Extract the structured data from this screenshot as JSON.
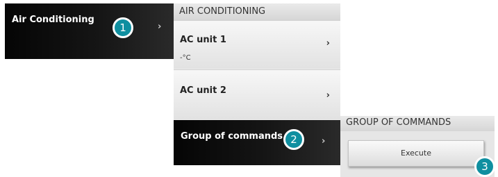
{
  "menu": {
    "label": "Air Conditioning",
    "chevron": "›",
    "badge": "1"
  },
  "ac_panel": {
    "header": "AIR CONDITIONING",
    "units": [
      {
        "name": "AC unit 1",
        "value": "-°C",
        "chevron": "›"
      },
      {
        "name": "AC unit 2",
        "value": "",
        "chevron": "›"
      }
    ],
    "group": {
      "label": "Group of commands",
      "chevron": "›",
      "badge": "2"
    }
  },
  "group_panel": {
    "header": "GROUP OF COMMANDS",
    "button": "Execute",
    "badge": "3"
  }
}
